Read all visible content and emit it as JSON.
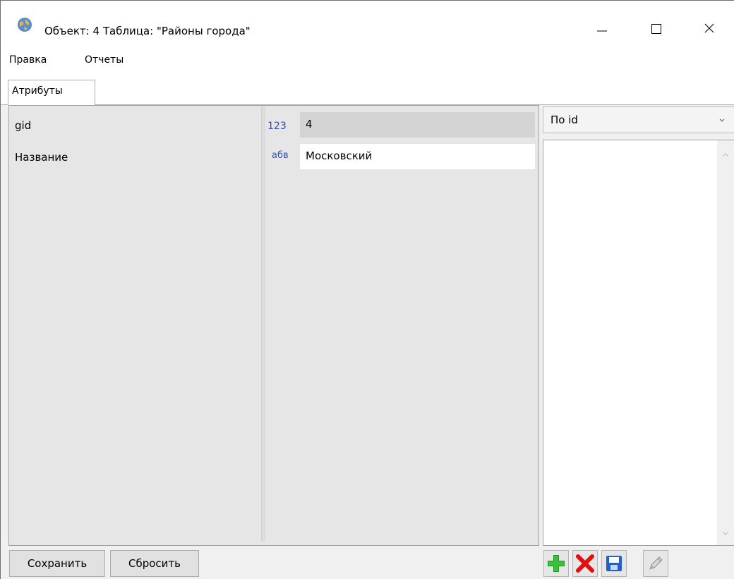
{
  "window": {
    "title": "Объект: 4 Таблица: \"Районы города\""
  },
  "menu": {
    "items": [
      {
        "label": "Правка"
      },
      {
        "label": "Отчеты"
      }
    ]
  },
  "tabs": [
    {
      "label": "Атрибуты",
      "active": true
    }
  ],
  "attributes": [
    {
      "name": "gid",
      "type_badge": "123",
      "value": "4",
      "readonly": true
    },
    {
      "name": "Название",
      "type_badge": "абв",
      "value": "Московский",
      "readonly": false
    }
  ],
  "sort": {
    "selected": "По id"
  },
  "buttons": {
    "save": "Сохранить",
    "reset": "Сбросить"
  },
  "toolbar_icons": [
    "add-icon",
    "delete-icon",
    "save-icon",
    "edit-icon"
  ],
  "colors": {
    "type_badge": "#2f4fbf",
    "add_green": "#1f9a1f",
    "delete_red": "#e01010",
    "save_blue": "#2060c8"
  }
}
